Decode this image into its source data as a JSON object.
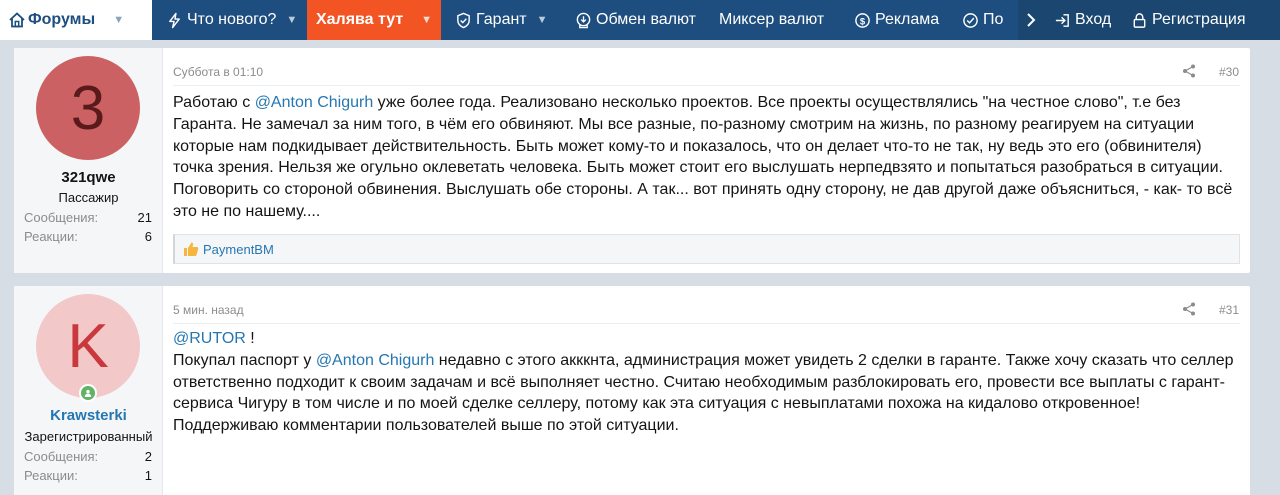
{
  "nav": {
    "forums": "Форумы",
    "whats_new": "Что нового?",
    "freebie": "Халява тут",
    "guarantee": "Гарант",
    "exchange": "Обмен валют",
    "mixer": "Миксер валют",
    "ads": "Реклама",
    "truncated": "По",
    "login": "Вход",
    "register": "Регистрация"
  },
  "colors": {
    "nav_bg": "#1d4e7f",
    "hot": "#f35424",
    "link": "#2577b1"
  },
  "posts": [
    {
      "avatar_letter": "3",
      "username": "321qwe",
      "user_title": "Пассажир",
      "messages_label": "Сообщения:",
      "messages": "21",
      "reactions_label": "Реакции:",
      "reactions": "6",
      "date": "Суббота в 01:10",
      "number": "#30",
      "mention": "@Anton Chigurh",
      "text_before": "Работаю с ",
      "text_after": " уже более года. Реализовано несколько проектов. Все проекты осуществлялись \"на честное слово\", т.е без Гаранта. Не замечал за ним того, в чём его обвиняют. Мы все разные, по-разному смотрим на жизнь, по разному реагируем на ситуации которые нам подкидывает действительность. Быть может кому-то и показалось, что он делает что-то не так, ну ведь это его (обвинителя) точка зрения. Нельзя же огульно оклеветать человека. Быть может стоит его выслушать нерпедвзято и попытаться разобраться в ситуации. Поговорить со стороной обвинения. Выслушать обе стороны. А так... вот принять одну сторону, не дав другой даже объясниться, - как- то всё это не по нашему....",
      "reaction_user": "PaymentBM"
    },
    {
      "avatar_letter": "K",
      "username": "Krawsterki",
      "user_title": "Зарегистрированный",
      "messages_label": "Сообщения:",
      "messages": "2",
      "reactions_label": "Реакции:",
      "reactions": "1",
      "date": "5 мин. назад",
      "number": "#31",
      "mention1": "@RUTOR",
      "after_mention1": " !",
      "line2_before": "Покупал паспорт у ",
      "mention2": "@Anton Chigurh",
      "line2_after": " недавно с этого акккнта, администрация может увидеть 2 сделки в гаранте. Также хочу сказать что селлер ответственно подходит к своим задачам и всё выполняет честно. Считаю необходимым разблокировать его, провести все выплаты с гарант-сервиса Чигуру в том числе и по моей сделке селлеру, потому как эта ситуация с невыплатами похожа на кидалово откровенное! Поддерживаю комментарии пользователей выше по этой ситуации."
    }
  ]
}
